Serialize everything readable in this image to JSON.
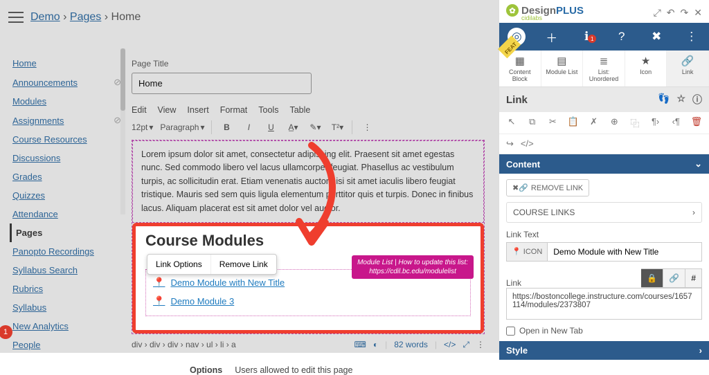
{
  "breadcrumb": {
    "demo": "Demo",
    "pages": "Pages",
    "sep": "›",
    "current": "Home"
  },
  "nav": {
    "items": [
      {
        "label": "Home",
        "hidden": false
      },
      {
        "label": "Announcements",
        "hidden": true
      },
      {
        "label": "Modules",
        "hidden": false
      },
      {
        "label": "Assignments",
        "hidden": true
      },
      {
        "label": "Course Resources",
        "hidden": false
      },
      {
        "label": "Discussions",
        "hidden": false
      },
      {
        "label": "Grades",
        "hidden": false
      },
      {
        "label": "Quizzes",
        "hidden": false
      },
      {
        "label": "Attendance",
        "hidden": false
      },
      {
        "label": "Pages",
        "hidden": false,
        "active": true
      },
      {
        "label": "Panopto Recordings",
        "hidden": false
      },
      {
        "label": "Syllabus Search",
        "hidden": false
      },
      {
        "label": "Rubrics",
        "hidden": false
      },
      {
        "label": "Syllabus",
        "hidden": false
      },
      {
        "label": "New Analytics",
        "hidden": false
      },
      {
        "label": "People",
        "hidden": false
      }
    ]
  },
  "page": {
    "title_label": "Page Title",
    "title_value": "Home",
    "menubar": [
      "Edit",
      "View",
      "Insert",
      "Format",
      "Tools",
      "Table"
    ],
    "font_size": "12pt",
    "para_style": "Paragraph",
    "lorem": "Lorem ipsum dolor sit amet, consectetur adipiscing elit. Praesent sit amet egestas nunc. Sed commodo libero vel lacus ullamcorper feugiat. Phasellus ac vestibulum turpis, ac sollicitudin erat. Etiam venenatis auctor nisi sit amet iaculis libero feugiat tristique. Mauris sed sem quis ligula elementum porttitor quis et turpis. Donec in finibus lacus. Aliquam placerat est sit amet dolor vel auctor.",
    "cm_heading": "Course Modules",
    "link_opts": {
      "a": "Link Options",
      "b": "Remove Link"
    },
    "mod1": "Demo Module with New Title",
    "mod3": "Demo Module 3",
    "ml_badge_a": "Module List | How to update this list:",
    "ml_badge_b": "https://cdil.bc.edu/modulelist",
    "dom_path": "div › div › div › nav › ul › li › a",
    "word_count": "82 words",
    "options_label": "Options",
    "options_text": "Users allowed to edit this page"
  },
  "right": {
    "brand_a": "Design",
    "brand_b": "PLUS",
    "brand_sub": "cidilabs",
    "tools": [
      {
        "icon": "▦",
        "label": "Content Block"
      },
      {
        "icon": "▤",
        "label": "Module List"
      },
      {
        "icon": "≣",
        "label": "List: Unordered"
      },
      {
        "icon": "★",
        "label": "Icon"
      },
      {
        "icon": "🔗",
        "label": "Link"
      }
    ],
    "section": "Link",
    "content_h": "Content",
    "remove_link": "REMOVE LINK",
    "course_links": "COURSE LINKS",
    "link_text_label": "Link Text",
    "icon_pre": "ICON",
    "link_text_value": "Demo Module with New Title",
    "link_label": "Link",
    "link_value": "https://bostoncollege.instructure.com/courses/1657114/modules/2373807",
    "open_new": "Open in New Tab",
    "style_h": "Style"
  },
  "notif": "1"
}
